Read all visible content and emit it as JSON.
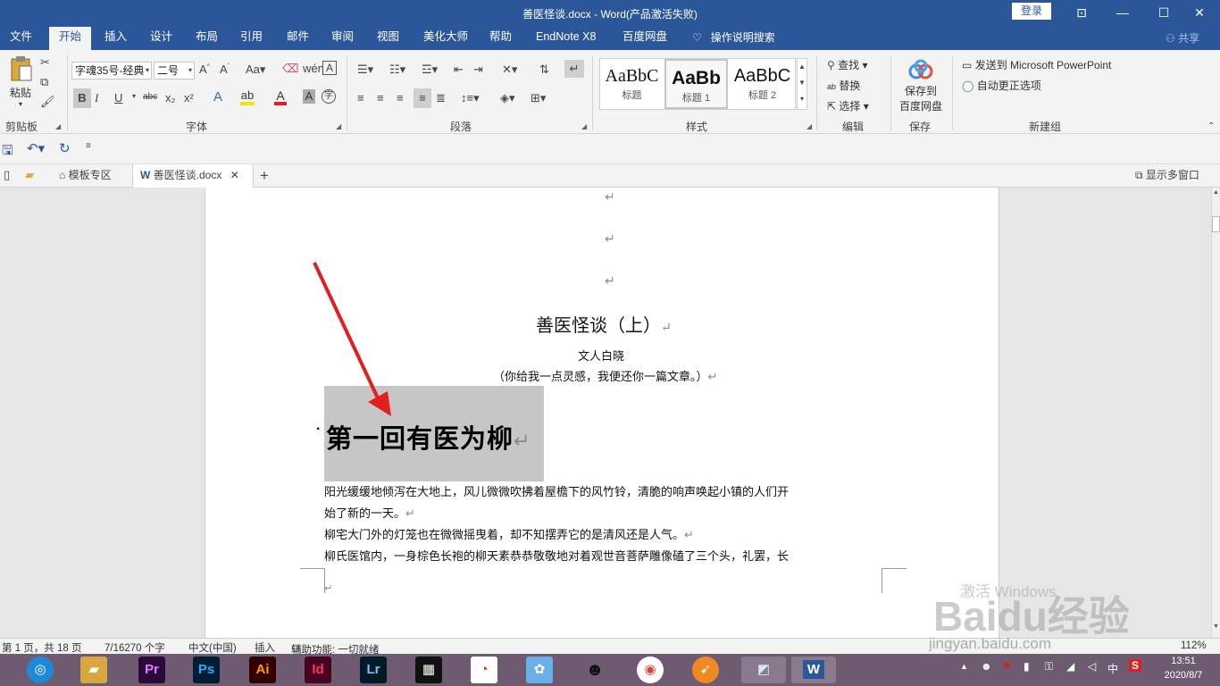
{
  "window": {
    "title": "善医怪谈.docx  -  Word(产品激活失败)",
    "login": "登录",
    "controls": [
      "⊡",
      "—",
      "☐",
      "✕"
    ]
  },
  "ribbon_tabs": [
    "文件",
    "开始",
    "插入",
    "设计",
    "布局",
    "引用",
    "邮件",
    "审阅",
    "视图",
    "美化大师",
    "帮助",
    "EndNote X8",
    "百度网盘"
  ],
  "active_tab": "开始",
  "tell_me": "操作说明搜索",
  "share": "共享",
  "clipboard": {
    "paste": "粘贴",
    "label": "剪贴板"
  },
  "font": {
    "name": "字魂35号-经典",
    "size": "二号",
    "label": "字体",
    "buttons": [
      "B",
      "I",
      "U",
      "abc",
      "x₂",
      "x²"
    ]
  },
  "paragraph": {
    "label": "段落"
  },
  "styles": {
    "label": "样式",
    "items": [
      {
        "preview": "AaBbC",
        "name": "标题"
      },
      {
        "preview": "AaBb",
        "name": "标题 1"
      },
      {
        "preview": "AaBbC",
        "name": "标题 2"
      }
    ]
  },
  "editing": {
    "find": "查找",
    "replace": "替换",
    "select": "选择",
    "label": "编辑"
  },
  "save_group": {
    "button": "保存到\n百度网盘",
    "button_l1": "保存到",
    "button_l2": "百度网盘",
    "label": "保存"
  },
  "new_group": {
    "send_ppt": "发送到 Microsoft PowerPoint",
    "autocorrect": "自动更正选项",
    "label": "新建组"
  },
  "doc_tabs": {
    "template": "模板专区",
    "current": "善医怪谈.docx",
    "multi_window": "显示多窗口"
  },
  "document": {
    "title": "善医怪谈（上）",
    "author": "文人白晓",
    "subtitle": "（你给我一点灵感，我便还你一篇文章。）",
    "heading": "第一回有医为柳",
    "para1_l1": "阳光缓缓地倾泻在大地上，风儿微微吹拂着屋檐下的风竹铃，清脆的响声唤起小镇的人们开",
    "para1_l2": "始了新的一天。",
    "para2": "柳宅大门外的灯笼也在微微摇曳着，却不知摆弄它的是清风还是人气。",
    "para3": "柳氏医馆内，一身棕色长袍的柳天素恭恭敬敬地对着观世音菩萨雕像磕了三个头，礼罢，长",
    "para_mark": "↵"
  },
  "status_bar": {
    "page": "第 1 页，共 18 页",
    "words": "7/16270 个字",
    "language": "中文(中国)",
    "mode": "插入",
    "accessibility": "辅助功能: 一切就绪",
    "zoom": "112%"
  },
  "watermark": {
    "activate": "激活 Windows",
    "baidu": "Baidu经验",
    "url": "jingyan.baidu.com"
  },
  "taskbar": {
    "apps": [
      "Pr",
      "Ps",
      "Ai",
      "Id",
      "Lr"
    ],
    "time": "13:51",
    "date": "2020/8/7",
    "ime": "中"
  },
  "colors": {
    "word_blue": "#2b579a",
    "ribbon_bg": "#f3f3f3",
    "arrow_red": "#e02020",
    "selection": "#c6c6c6"
  }
}
